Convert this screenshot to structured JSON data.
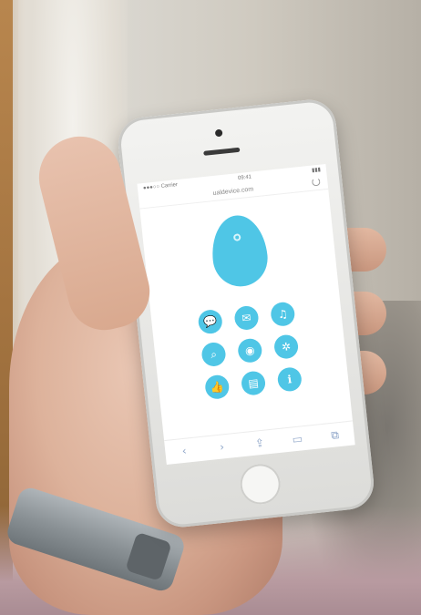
{
  "colors": {
    "accent": "#4fc6e6",
    "skin": "#ddb29b",
    "phone_body": "#eeeeeb",
    "toolbar_icon": "#8fa6c9"
  },
  "screen": {
    "status_left": "●●●○○ Carrier",
    "status_center": "09:41",
    "status_right": "▮▮▮",
    "url": "ualdevice.com"
  },
  "app_icons": [
    {
      "icon": "chat-bubble-icon",
      "glyph": "💬"
    },
    {
      "icon": "message-icon",
      "glyph": "✉"
    },
    {
      "icon": "music-note-icon",
      "glyph": "♫"
    },
    {
      "icon": "search-icon",
      "glyph": "⌕"
    },
    {
      "icon": "camera-icon",
      "glyph": "◉"
    },
    {
      "icon": "settings-icon",
      "glyph": "✲"
    },
    {
      "icon": "thumbs-up-icon",
      "glyph": "👍"
    },
    {
      "icon": "book-icon",
      "glyph": "▤"
    },
    {
      "icon": "info-icon",
      "glyph": "ℹ"
    }
  ],
  "toolbar": {
    "back": "‹",
    "forward": "›",
    "share": "⇪",
    "bookmarks": "▭",
    "tabs": "⧉"
  }
}
